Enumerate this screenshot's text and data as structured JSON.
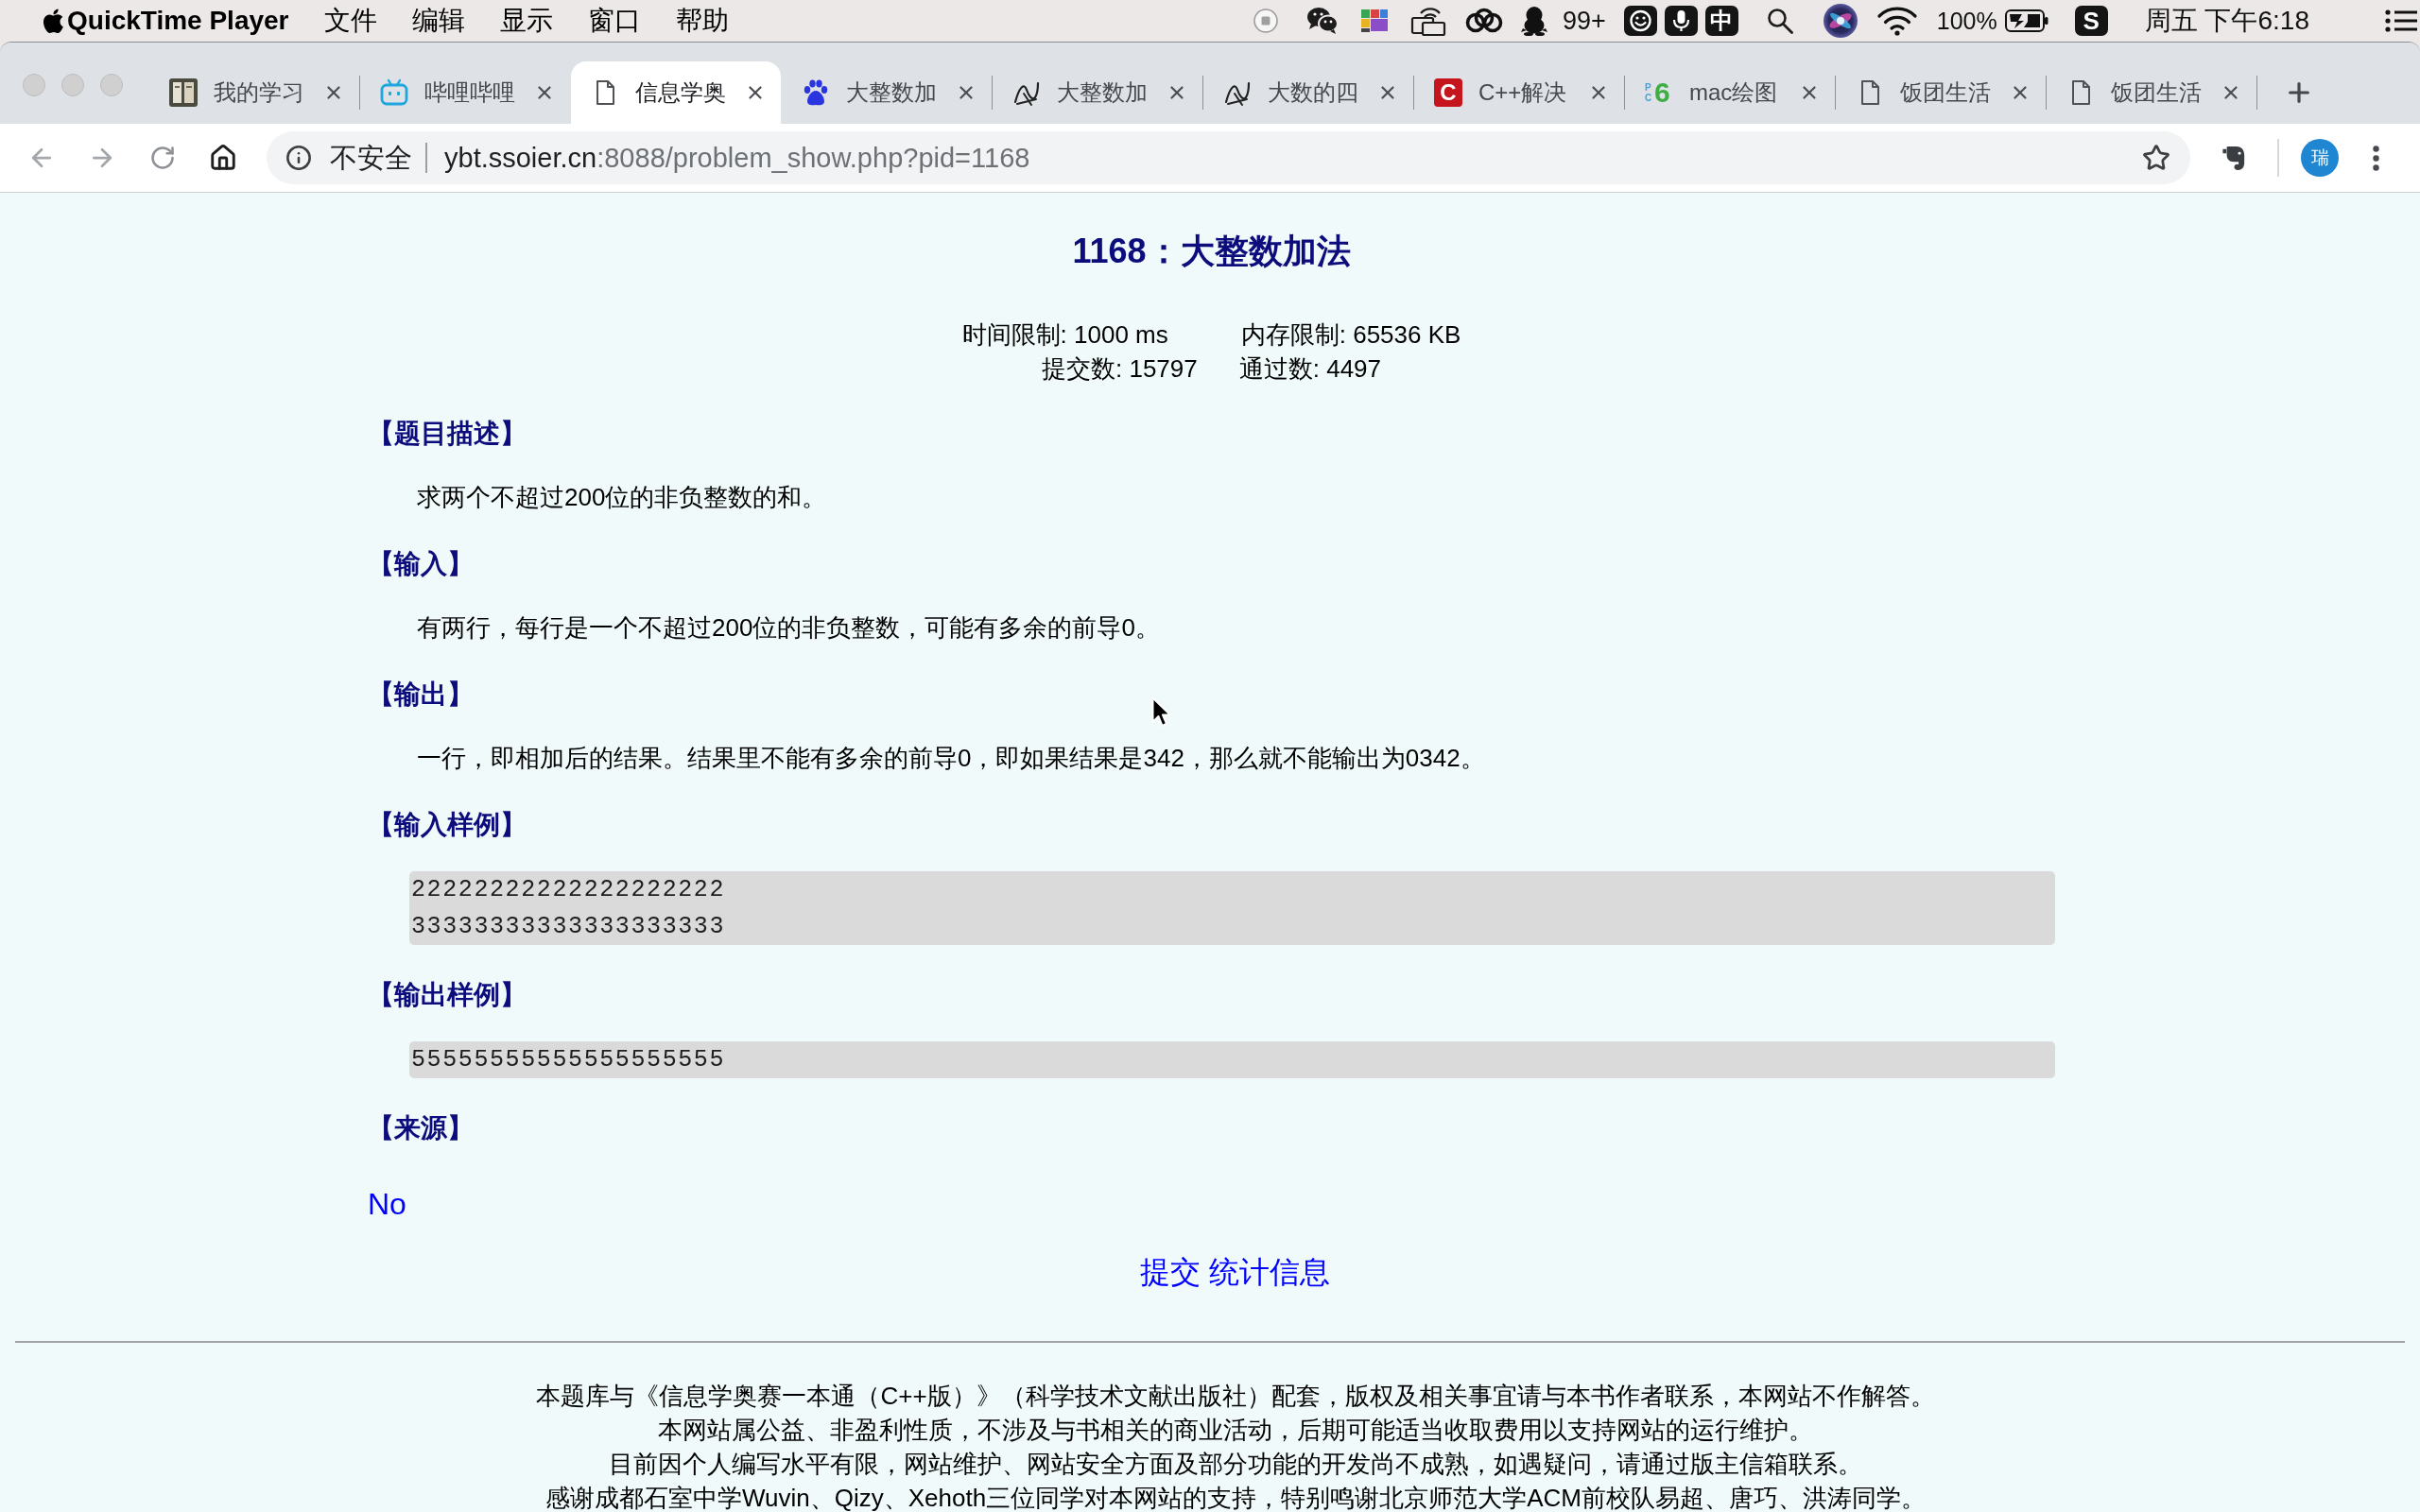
{
  "menu_bar": {
    "app_name": "QuickTime Player",
    "menus": [
      "文件",
      "编辑",
      "显示",
      "窗口",
      "帮助"
    ],
    "notification_count": "99+",
    "input_method": "中",
    "battery_percent": "100%",
    "logo_letter": "S",
    "clock": "周五 下午6:18"
  },
  "browser": {
    "tabs": [
      {
        "title": "我的学习",
        "favicon": {
          "kind": "thumb"
        },
        "selected": false
      },
      {
        "title": "哔哩哔哩",
        "favicon": {
          "kind": "tv"
        },
        "selected": false
      },
      {
        "title": "信息学奥",
        "favicon": {
          "kind": "page"
        },
        "selected": true
      },
      {
        "title": "大整数加",
        "favicon": {
          "kind": "paw"
        },
        "selected": false
      },
      {
        "title": "大整数加",
        "favicon": {
          "kind": "scribble"
        },
        "selected": false
      },
      {
        "title": "大数的四",
        "favicon": {
          "kind": "scribble"
        },
        "selected": false
      },
      {
        "title": "C++解决",
        "favicon": {
          "kind": "tile",
          "text": "C"
        },
        "selected": false
      },
      {
        "title": "mac绘图",
        "favicon": {
          "kind": "mark",
          "small": "PC",
          "text": "6"
        },
        "selected": false
      },
      {
        "title": "饭团生活",
        "favicon": {
          "kind": "page"
        },
        "selected": false
      },
      {
        "title": "饭团生活",
        "favicon": {
          "kind": "page"
        },
        "selected": false
      }
    ],
    "address_bar": {
      "security_label": "不安全",
      "host": "ybt.ssoier.cn",
      "path": ":8088/problem_show.php?pid=1168"
    },
    "profile_initial": "瑞"
  },
  "problem": {
    "title": "1168：大整数加法",
    "limits": [
      "时间限制: 1000 ms",
      "内存限制: 65536 KB"
    ],
    "counts": [
      "提交数: 15797",
      "通过数: 4497"
    ],
    "sections": [
      {
        "kind": "text",
        "heading": "【题目描述】",
        "body": "求两个不超过200位的非负整数的和。"
      },
      {
        "kind": "text",
        "heading": "【输入】",
        "body": "有两行，每行是一个不超过200位的非负整数，可能有多余的前导0。"
      },
      {
        "kind": "text",
        "heading": "【输出】",
        "body": "一行，即相加后的结果。结果里不能有多余的前导0，即如果结果是342，那么就不能输出为0342。"
      },
      {
        "kind": "sample",
        "heading": "【输入样例】",
        "lines": [
          "22222222222222222222",
          "33333333333333333333"
        ]
      },
      {
        "kind": "sample",
        "heading": "【输出样例】",
        "lines": [
          "55555555555555555555"
        ]
      },
      {
        "kind": "link",
        "heading": "【来源】",
        "body": "No"
      }
    ],
    "actions": [
      "提交",
      "统计信息"
    ]
  },
  "footer": [
    "本题库与《信息学奥赛一本通（C++版）》（科学技术文献出版社）配套，版权及相关事宜请与本书作者联系，本网站不作解答。",
    "本网站属公益、非盈利性质，不涉及与书相关的商业活动，后期可能适当收取费用以支持网站的运行维护。",
    "目前因个人编写水平有限，网站维护、网站安全方面及部分功能的开发尚不成熟，如遇疑问，请通过版主信箱联系。",
    "感谢成都石室中学Wuvin、Qizy、Xehoth三位同学对本网站的支持，特别鸣谢北京师范大学ACM前校队易超、唐巧、洪涛同学。"
  ]
}
